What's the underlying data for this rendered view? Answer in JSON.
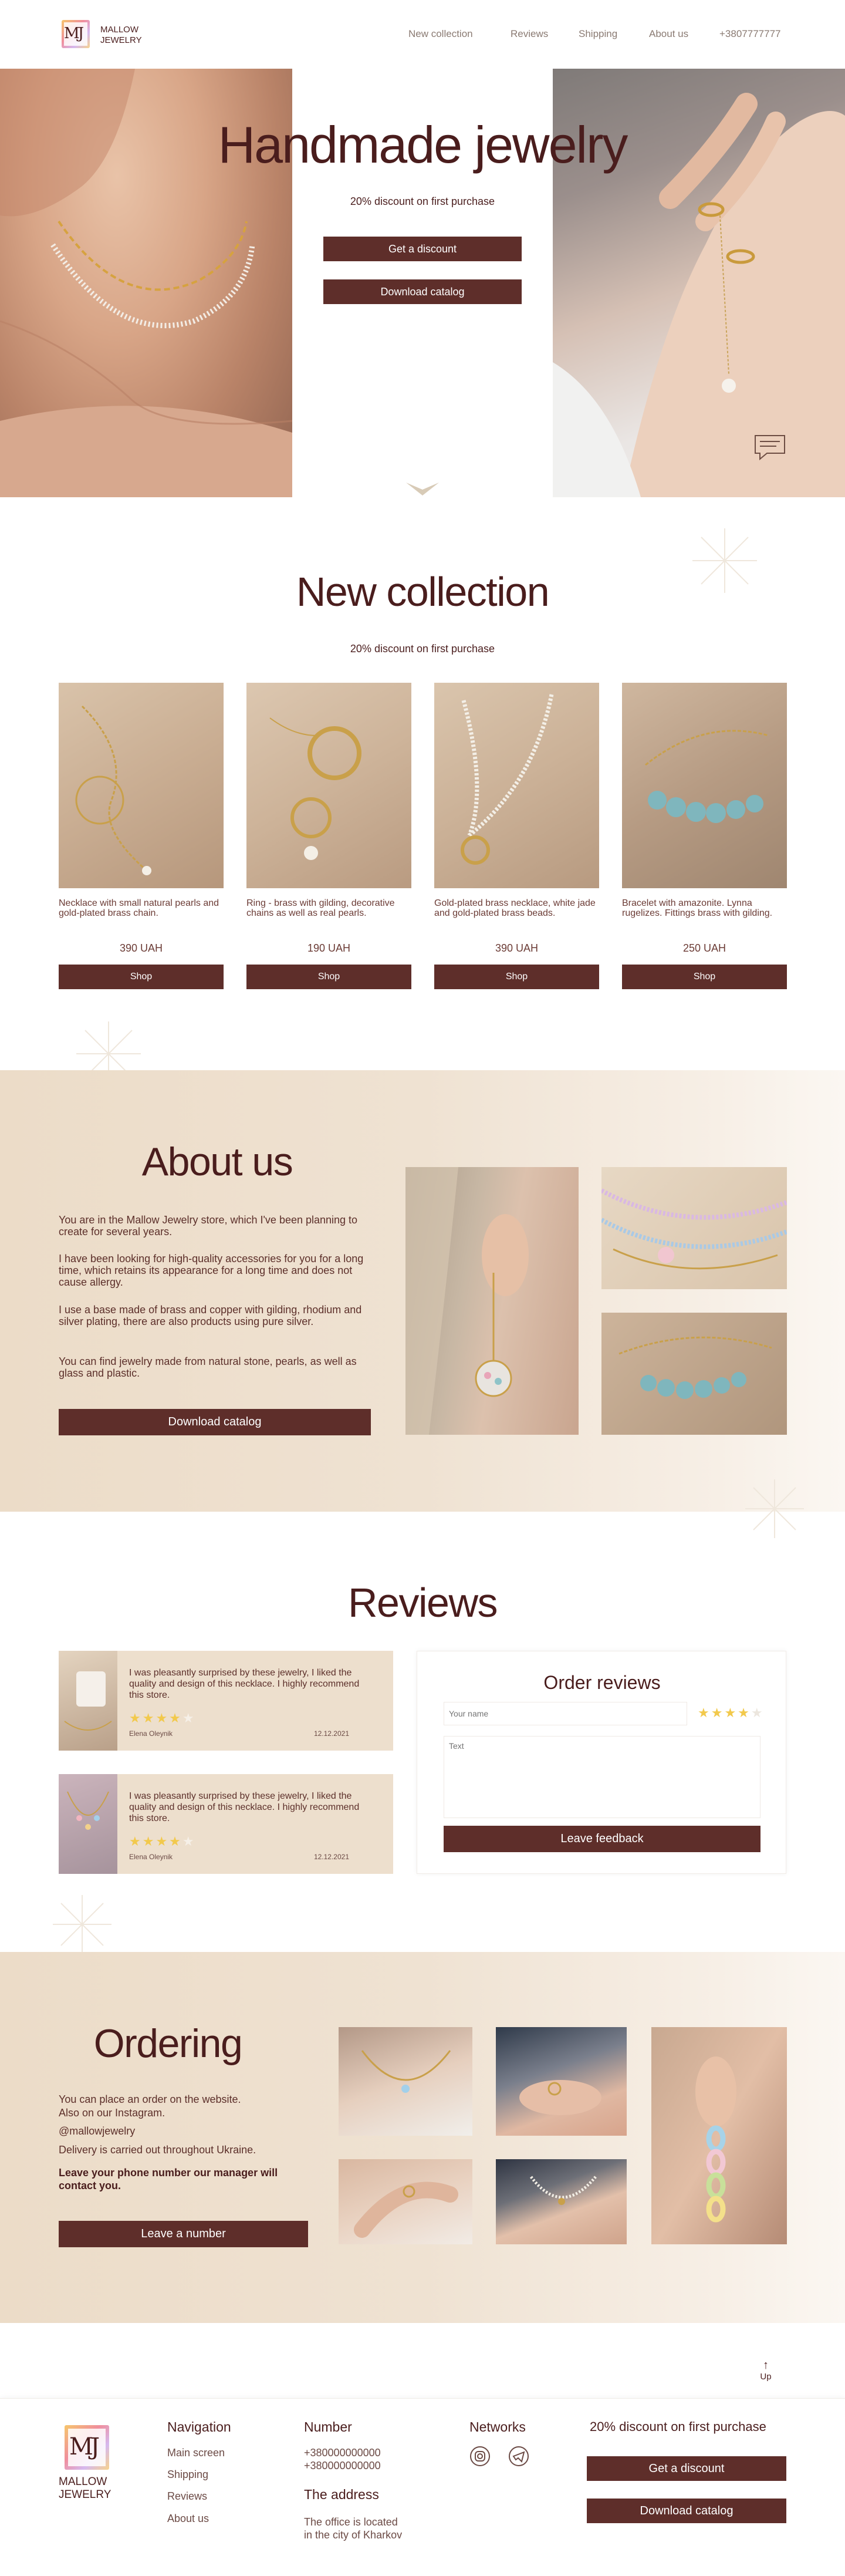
{
  "brand": {
    "monogram": "MJ",
    "name_line1": "MALLOW",
    "name_line2": "JEWELRY"
  },
  "header": {
    "nav": [
      "New collection",
      "Reviews",
      "Shipping",
      "About us"
    ],
    "phone": "+3807777777"
  },
  "hero": {
    "title": "Handmade jewelry",
    "subtitle": "20% discount on first purchase",
    "discount_button": "Get a discount",
    "catalog_button": "Download catalog"
  },
  "collection": {
    "title": "New collection",
    "subtitle": "20% discount on first purchase",
    "products": [
      {
        "desc": "Necklace with small natural pearls and gold-plated brass chain.",
        "price": "390 UAH",
        "button": "Shop"
      },
      {
        "desc": "Ring - brass with gilding, decorative chains as well as real pearls.",
        "price": "190 UAH",
        "button": "Shop"
      },
      {
        "desc": "Gold-plated brass necklace, white jade and gold-plated brass beads.",
        "price": "390 UAH",
        "button": "Shop"
      },
      {
        "desc": "Bracelet with amazonite. Lynna rugelizes. Fittings brass with gilding.",
        "price": "250 UAH",
        "button": "Shop"
      }
    ]
  },
  "about": {
    "title": "About us",
    "p1": "You are in the Mallow Jewelry store, which I've been planning to create for several years.",
    "p2": "I have been looking for high-quality accessories for you for a long time, which retains its appearance for a long time and does not cause allergy.",
    "p3": "I use a base made of brass and copper with gilding, rhodium and silver plating, there are also products using pure silver.",
    "p4": "You can find jewelry made from natural stone, pearls, as well as glass and plastic.",
    "button": "Download catalog"
  },
  "reviews": {
    "title": "Reviews",
    "items": [
      {
        "text": "I was pleasantly surprised by these jewelry, I liked the quality and design of this necklace. I highly recommend this store.",
        "rating": 4,
        "name": "Elena Oleynik",
        "date": "12.12.2021"
      },
      {
        "text": "I was pleasantly surprised by these jewelry, I liked the quality and design of this necklace. I highly recommend this store.",
        "rating": 4,
        "name": "Elena Oleynik",
        "date": "12.12.2021"
      }
    ],
    "form": {
      "title": "Order reviews",
      "name_placeholder": "Your name",
      "text_placeholder": "Text",
      "rating": 4,
      "button": "Leave feedback"
    }
  },
  "ordering": {
    "title": "Ordering",
    "line1": "You can place an order on the website.",
    "line2": "Also on our Instagram.",
    "instagram": "@mallowjewelry",
    "delivery": "Delivery is carried out throughout Ukraine.",
    "call": "Leave your phone number our manager will contact you.",
    "button": "Leave a number"
  },
  "up": {
    "arrow": "↑",
    "label": "Up"
  },
  "footer": {
    "nav_title": "Navigation",
    "nav_items": [
      "Main screen",
      "Shipping",
      "Reviews",
      "About us"
    ],
    "number_title": "Number",
    "phones": [
      "+380000000000",
      "+380000000000"
    ],
    "address_title": "The address",
    "address_line1": "The office is located",
    "address_line2": "in the city of Kharkov",
    "networks_title": "Networks",
    "promo": "20% discount on first purchase",
    "discount_button": "Get a discount",
    "catalog_button": "Download catalog"
  },
  "colors": {
    "accent": "#5e2e2a",
    "heading": "#4a1d1d",
    "tan": "#ecdcc8",
    "star": "#f2c94c"
  },
  "icons": [
    "chevron-down-icon",
    "chat-icon",
    "instagram-icon",
    "telegram-icon",
    "sparkle-icon"
  ]
}
